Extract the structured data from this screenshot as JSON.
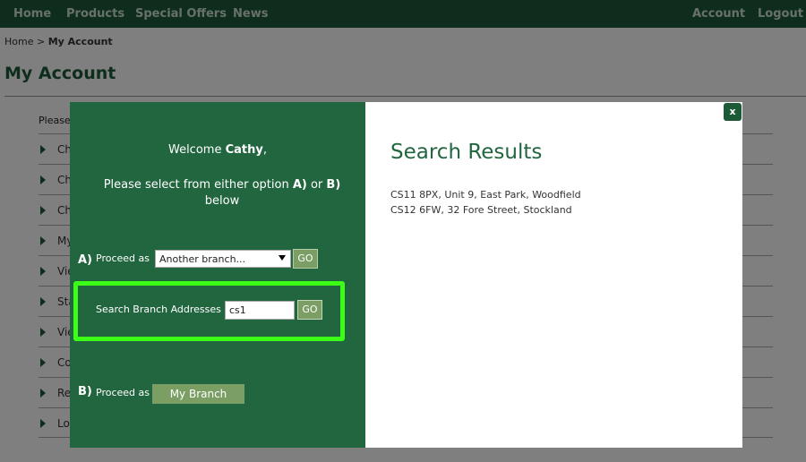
{
  "nav": {
    "left": [
      "Home",
      "Products",
      "Special Offers",
      "News"
    ],
    "right": [
      "Account",
      "Logout"
    ]
  },
  "breadcrumb": {
    "home": "Home",
    "separator": " > ",
    "current": "My Account"
  },
  "page_title": "My Account",
  "intro_text": "Please",
  "account_list": [
    "Ch",
    "Ch",
    "Ch",
    "My",
    "Vie",
    "Sta",
    "Vie",
    "Co",
    "Re",
    "Lo"
  ],
  "modal": {
    "welcome_prefix": "Welcome ",
    "welcome_name": "Cathy",
    "welcome_suffix": ",",
    "instruction_prefix": "Please select from either option ",
    "option_a_letter_inline": "A)",
    "instruction_or": " or ",
    "option_b_letter_inline": "B)",
    "instruction_suffix": " below",
    "option_a": {
      "letter": "A)",
      "label": "Proceed as",
      "select_value": "Another branch...",
      "go_label": "GO"
    },
    "search": {
      "label": "Search Branch Addresses",
      "value": "cs1",
      "go_label": "GO"
    },
    "option_b": {
      "letter": "B)",
      "label": "Proceed as",
      "button_label": "My Branch"
    },
    "results": {
      "title": "Search Results",
      "lines": [
        "CS11 8PX, Unit 9, East Park, Woodfield",
        "CS12 6FW, 32 Fore Street, Stockland"
      ]
    },
    "close_label": "x"
  },
  "colors": {
    "brand_green": "#1d5a38",
    "panel_green": "#226640",
    "button_green": "#7a9e64",
    "highlight": "#3cff18"
  }
}
